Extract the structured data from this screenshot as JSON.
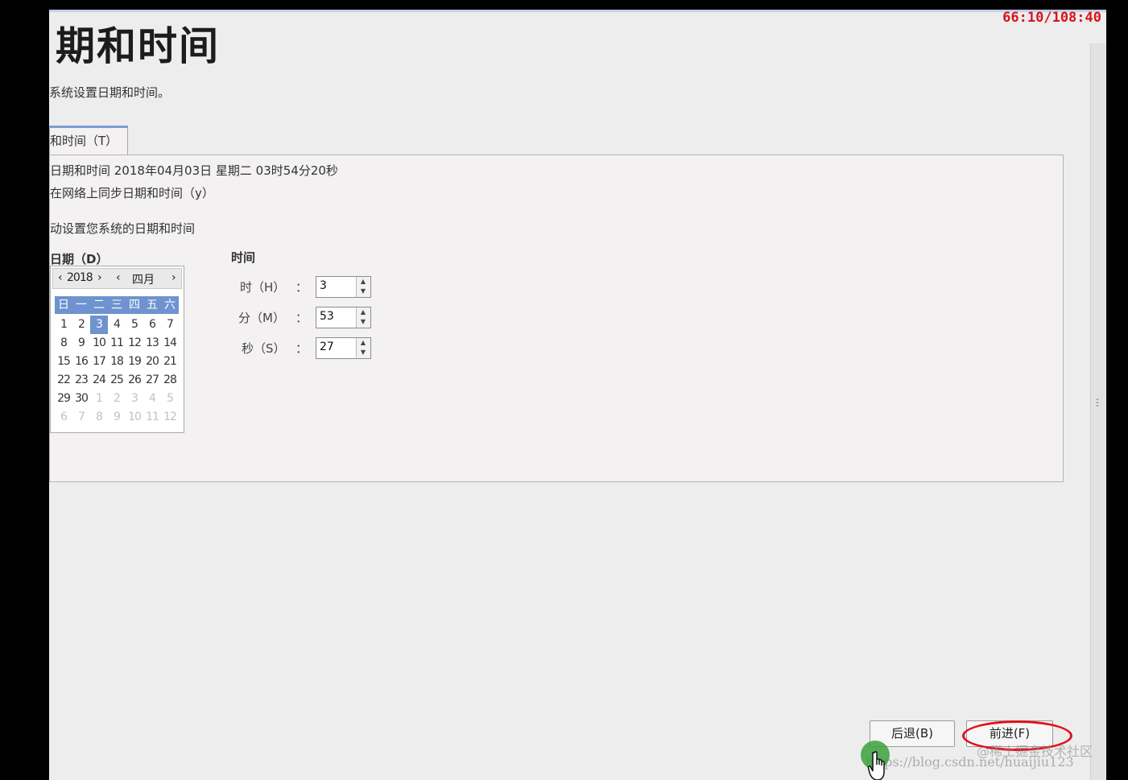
{
  "timer": "66:10/108:40",
  "title": "期和时间",
  "description": "系统设置日期和时间。",
  "tab_label": "和时间（T）",
  "panel": {
    "current_datetime": "日期和时间  2018年04月03日  星期二  03时54分20秒",
    "sync_network": "在网络上同步日期和时间（y）",
    "manual_setting": "动设置您系统的日期和时间",
    "date_heading": "日期（D）",
    "time_heading": "时间"
  },
  "calendar": {
    "year": "2018",
    "month": "四月",
    "weekdays": [
      "日",
      "一",
      "二",
      "三",
      "四",
      "五",
      "六"
    ],
    "weeks": [
      [
        {
          "d": "1"
        },
        {
          "d": "2"
        },
        {
          "d": "3",
          "sel": true
        },
        {
          "d": "4"
        },
        {
          "d": "5"
        },
        {
          "d": "6"
        },
        {
          "d": "7"
        }
      ],
      [
        {
          "d": "8"
        },
        {
          "d": "9"
        },
        {
          "d": "10"
        },
        {
          "d": "11"
        },
        {
          "d": "12"
        },
        {
          "d": "13"
        },
        {
          "d": "14"
        }
      ],
      [
        {
          "d": "15"
        },
        {
          "d": "16"
        },
        {
          "d": "17"
        },
        {
          "d": "18"
        },
        {
          "d": "19"
        },
        {
          "d": "20"
        },
        {
          "d": "21"
        }
      ],
      [
        {
          "d": "22"
        },
        {
          "d": "23"
        },
        {
          "d": "24"
        },
        {
          "d": "25"
        },
        {
          "d": "26"
        },
        {
          "d": "27"
        },
        {
          "d": "28"
        }
      ],
      [
        {
          "d": "29"
        },
        {
          "d": "30"
        },
        {
          "d": "1",
          "dim": true
        },
        {
          "d": "2",
          "dim": true
        },
        {
          "d": "3",
          "dim": true
        },
        {
          "d": "4",
          "dim": true
        },
        {
          "d": "5",
          "dim": true
        }
      ],
      [
        {
          "d": "6",
          "dim": true
        },
        {
          "d": "7",
          "dim": true
        },
        {
          "d": "8",
          "dim": true
        },
        {
          "d": "9",
          "dim": true
        },
        {
          "d": "10",
          "dim": true
        },
        {
          "d": "11",
          "dim": true
        },
        {
          "d": "12",
          "dim": true
        }
      ]
    ]
  },
  "time": {
    "hour_label": "时（H）",
    "hour_value": "3",
    "minute_label": "分（M）",
    "minute_value": "53",
    "second_label": "秒（S）",
    "second_value": "27",
    "colon": "："
  },
  "buttons": {
    "back": "后退(B)",
    "forward": "前进(F)"
  },
  "watermark_url": "https://blog.csdn.net/huaijiu123",
  "watermark_site": "@稀土掘金技术社区",
  "colors": {
    "accent": "#6e93cf",
    "timer": "#d8141b",
    "highlight": "#e3101b"
  }
}
